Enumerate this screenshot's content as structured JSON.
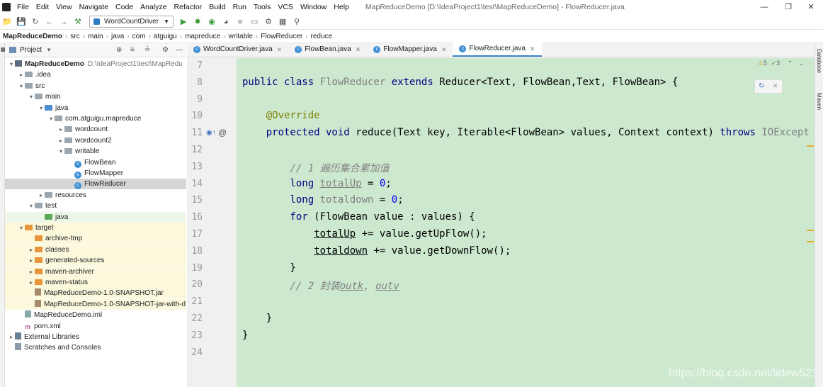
{
  "menu": [
    "File",
    "Edit",
    "View",
    "Navigate",
    "Code",
    "Analyze",
    "Refactor",
    "Build",
    "Run",
    "Tools",
    "VCS",
    "Window",
    "Help"
  ],
  "window_title": "MapReduceDemo [D:\\IdeaProject1\\test\\MapReduceDemo] - FlowReducer.java",
  "run_config": "WordCountDriver",
  "breadcrumbs": [
    "MapReduceDemo",
    "src",
    "main",
    "java",
    "com",
    "atguigu",
    "mapreduce",
    "writable",
    "FlowReducer",
    "reduce"
  ],
  "project_header": "Project",
  "side_labels": {
    "database": "Database",
    "maven": "Maven"
  },
  "tree": [
    {
      "label": "MapReduceDemo",
      "path": "D:\\IdeaProject1\\test\\MapRedu",
      "depth": 0,
      "arrow": "v",
      "icon": "module-icon"
    },
    {
      "label": ".idea",
      "depth": 1,
      "arrow": ">",
      "icon": "folder-icon"
    },
    {
      "label": "src",
      "depth": 1,
      "arrow": "v",
      "icon": "folder-icon"
    },
    {
      "label": "main",
      "depth": 2,
      "arrow": "v",
      "icon": "folder-icon"
    },
    {
      "label": "java",
      "depth": 3,
      "arrow": "v",
      "icon": "folder-icon"
    },
    {
      "label": "com.atguigu.mapreduce",
      "depth": 4,
      "arrow": "v",
      "icon": "folder-icon"
    },
    {
      "label": "wordcount",
      "depth": 5,
      "arrow": ">",
      "icon": "folder-icon"
    },
    {
      "label": "wordcount2",
      "depth": 5,
      "arrow": ">",
      "icon": "folder-icon"
    },
    {
      "label": "writable",
      "depth": 5,
      "arrow": "v",
      "icon": "folder-icon"
    },
    {
      "label": "FlowBean",
      "depth": 6,
      "arrow": "",
      "icon": "class-icon"
    },
    {
      "label": "FlowMapper",
      "depth": 6,
      "arrow": "",
      "icon": "class-icon"
    },
    {
      "label": "FlowReducer",
      "depth": 6,
      "arrow": "",
      "icon": "class-icon",
      "selected": true
    },
    {
      "label": "resources",
      "depth": 3,
      "arrow": ">",
      "icon": "folder-icon"
    },
    {
      "label": "test",
      "depth": 2,
      "arrow": "v",
      "icon": "folder-icon"
    },
    {
      "label": "java",
      "depth": 3,
      "arrow": "",
      "icon": "folder-icon",
      "green": true
    },
    {
      "label": "target",
      "depth": 1,
      "arrow": "v",
      "icon": "folder-icon",
      "target": true
    },
    {
      "label": "archive-tmp",
      "depth": 2,
      "arrow": "",
      "icon": "folder-icon",
      "target": true
    },
    {
      "label": "classes",
      "depth": 2,
      "arrow": ">",
      "icon": "folder-icon",
      "target": true
    },
    {
      "label": "generated-sources",
      "depth": 2,
      "arrow": ">",
      "icon": "folder-icon",
      "target": true
    },
    {
      "label": "maven-archiver",
      "depth": 2,
      "arrow": ">",
      "icon": "folder-icon",
      "target": true
    },
    {
      "label": "maven-status",
      "depth": 2,
      "arrow": ">",
      "icon": "folder-icon",
      "target": true
    },
    {
      "label": "MapReduceDemo-1.0-SNAPSHOT.jar",
      "depth": 2,
      "arrow": "",
      "icon": "jar-icon",
      "target": true
    },
    {
      "label": "MapReduceDemo-1.0-SNAPSHOT-jar-with-d",
      "depth": 2,
      "arrow": "",
      "icon": "jar-icon",
      "target": true
    },
    {
      "label": "MapReduceDemo.iml",
      "depth": 1,
      "arrow": "",
      "icon": "file-icon"
    },
    {
      "label": "pom.xml",
      "depth": 1,
      "arrow": "",
      "icon": "maven-icon"
    },
    {
      "label": "External Libraries",
      "depth": 0,
      "arrow": ">",
      "icon": "library-icon"
    },
    {
      "label": "Scratches and Consoles",
      "depth": 0,
      "arrow": "",
      "icon": "scratch-icon"
    }
  ],
  "tabs": [
    {
      "label": "WordCountDriver.java",
      "active": false
    },
    {
      "label": "FlowBean.java",
      "active": false
    },
    {
      "label": "FlowMapper.java",
      "active": false
    },
    {
      "label": "FlowReducer.java",
      "active": true
    }
  ],
  "inspections": {
    "warnings": "5",
    "ok": "3"
  },
  "code_lines": [
    {
      "n": "7",
      "html": ""
    },
    {
      "n": "8",
      "html": "<span class='kw'>public class</span> <span class='cn'>FlowReducer</span> <span class='kw'>extends</span> Reducer&lt;Text, FlowBean,Text, FlowBean&gt; {"
    },
    {
      "n": "9",
      "html": ""
    },
    {
      "n": "10",
      "html": "    <span class='an'>@Override</span>"
    },
    {
      "n": "11",
      "html": "    <span class='kw'>protected void</span> reduce(Text key, Iterable&lt;FlowBean&gt; values, Context context) <span class='kw'>throws</span> <span class='cn'>IOExcept</span>"
    },
    {
      "n": "12",
      "html": ""
    },
    {
      "n": "13",
      "html": "        <span class='cm'>// 1 遍历集合累加值</span>"
    },
    {
      "n": "14",
      "html": "        <span class='kw'>long</span> <span class='cn ul'>totalUp</span> = <span class='num'>0</span>;"
    },
    {
      "n": "15",
      "html": "        <span class='kw'>long</span> <span class='cn'>totaldown</span> = <span class='num'>0</span>;"
    },
    {
      "n": "16",
      "html": "        <span class='kw'>for</span> (FlowBean value : values) {"
    },
    {
      "n": "17",
      "html": "            <span class='ul'>totalUp</span> += value.getUpFlow();"
    },
    {
      "n": "18",
      "html": "            <span class='ul'>totaldown</span> += value.getDownFlow();"
    },
    {
      "n": "19",
      "html": "        }"
    },
    {
      "n": "20",
      "html": "        <span class='cm'>// 2 封装<span class='ul'>outk</span>, <span class='ul'>outv</span></span>"
    },
    {
      "n": "21",
      "html": ""
    },
    {
      "n": "22",
      "html": "    }"
    },
    {
      "n": "23",
      "html": "}"
    },
    {
      "n": "24",
      "html": ""
    }
  ],
  "watermark": "https://blog.csdn.net/lidew521"
}
